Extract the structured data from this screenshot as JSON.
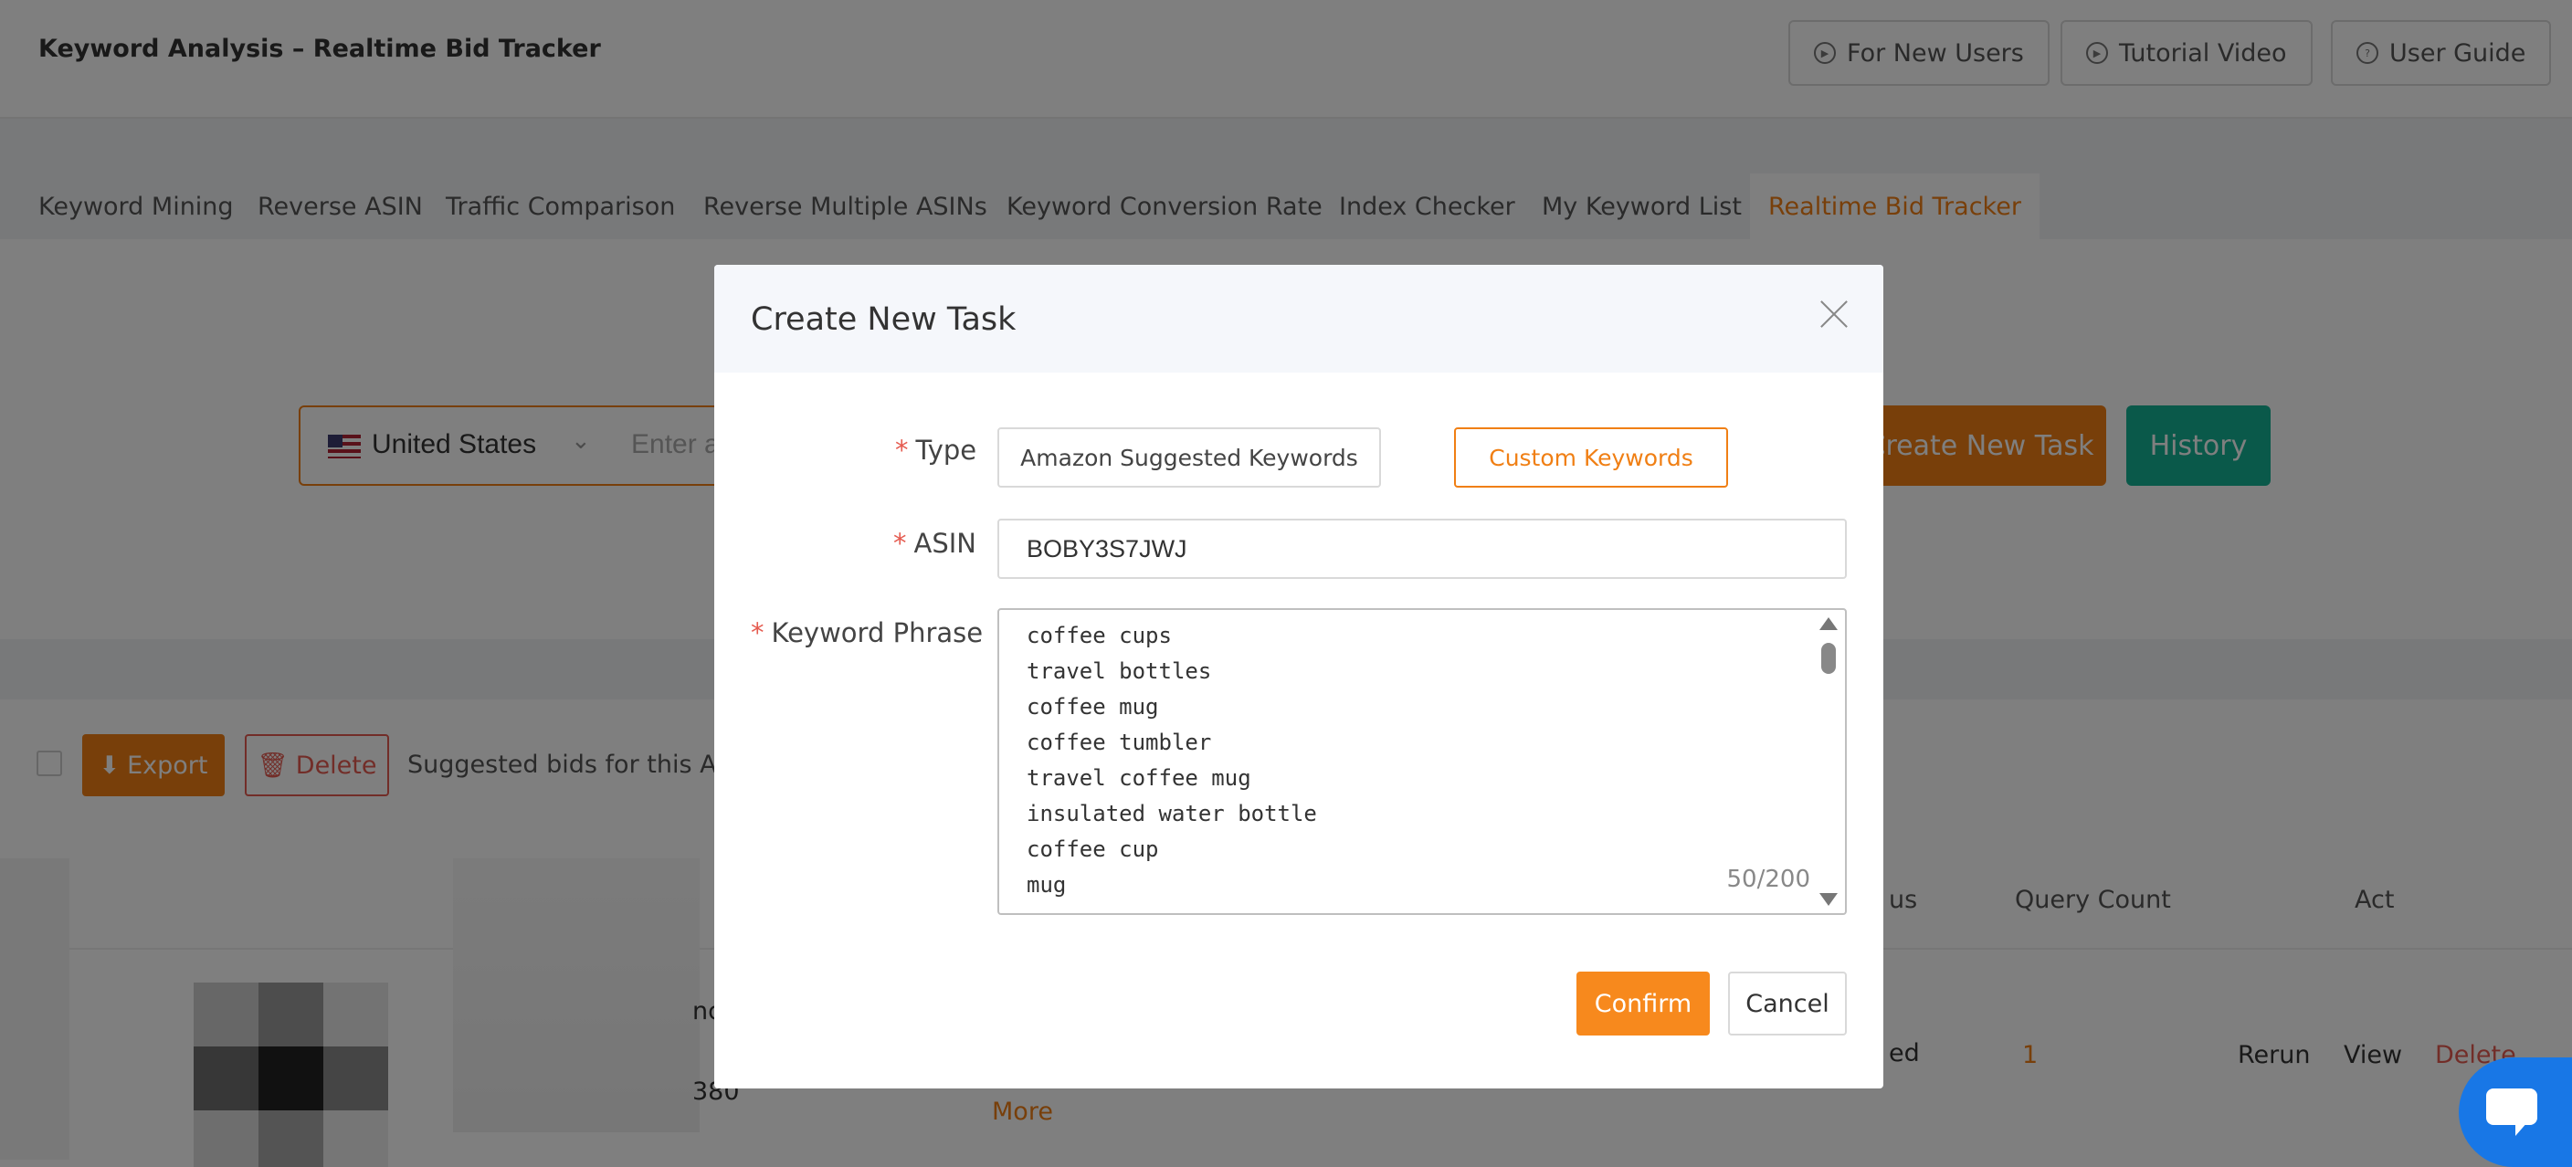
{
  "header": {
    "title": "Keyword Analysis – Realtime Bid Tracker",
    "buttons": [
      "For New Users",
      "Tutorial Video",
      "User Guide"
    ]
  },
  "tabs": [
    "Keyword Mining",
    "Reverse ASIN",
    "Traffic Comparison",
    "Reverse Multiple ASINs",
    "Keyword Conversion Rate",
    "Index Checker",
    "My Keyword List",
    "Realtime Bid Tracker"
  ],
  "active_tab": "Realtime Bid Tracker",
  "search": {
    "country": "United States",
    "placeholder": "Enter a",
    "create_button": "Create New Task",
    "history_button": "History"
  },
  "toolbar": {
    "export_label": "Export",
    "delete_label": "Delete",
    "info_text": "Suggested bids for this AS"
  },
  "table": {
    "headers": {
      "status": "us",
      "query_count": "Query Count",
      "action": "Act"
    },
    "row": {
      "fragment_a": "nc",
      "fragment_b": "380",
      "more": "More",
      "status": "ed",
      "query_count": "1",
      "rerun": "Rerun",
      "view": "View",
      "delete": "Delete"
    }
  },
  "modal": {
    "title": "Create New Task",
    "type_label": "Type",
    "type_options": [
      "Amazon Suggested Keywords",
      "Custom Keywords"
    ],
    "type_selected": "Custom Keywords",
    "asin_label": "ASIN",
    "asin_value": "BOBY3S7JWJ",
    "keyword_label": "Keyword Phrase",
    "keywords": [
      "coffee cups",
      "travel bottles",
      "coffee mug",
      "coffee tumbler",
      "travel coffee mug",
      "insulated water bottle",
      "coffee cup",
      "mug"
    ],
    "counter": "50/200",
    "confirm_label": "Confirm",
    "cancel_label": "Cancel"
  },
  "colors": {
    "accent": "#f07f14",
    "teal": "#14b294",
    "danger": "#e55b50",
    "overlay": "rgba(0,0,0,0.5)",
    "chat": "#1877e6"
  }
}
